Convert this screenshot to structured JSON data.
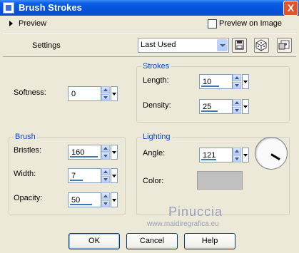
{
  "window": {
    "title": "Brush Strokes",
    "close": "X"
  },
  "preview": {
    "label": "Preview",
    "on_image_label": "Preview on Image",
    "on_image_checked": false
  },
  "settings": {
    "label": "Settings",
    "value": "Last Used"
  },
  "softness": {
    "label": "Softness:",
    "value": "0",
    "fill": 0
  },
  "strokes": {
    "title": "Strokes",
    "length": {
      "label": "Length:",
      "value": "10",
      "fill": 0.6
    },
    "density": {
      "label": "Density:",
      "value": "25",
      "fill": 0.55
    }
  },
  "brush": {
    "title": "Brush",
    "bristles": {
      "label": "Bristles:",
      "value": "160",
      "fill": 0.95
    },
    "width": {
      "label": "Width:",
      "value": "7",
      "fill": 0.45
    },
    "opacity": {
      "label": "Opacity:",
      "value": "50",
      "fill": 0.75
    }
  },
  "lighting": {
    "title": "Lighting",
    "angle": {
      "label": "Angle:",
      "value": "121",
      "fill": 0.5
    },
    "color": {
      "label": "Color:",
      "swatch": "#c0c0c0"
    }
  },
  "watermark": {
    "line1": "Pinuccia",
    "line2": "www.maidiregrafica.eu"
  },
  "buttons": {
    "ok": "OK",
    "cancel": "Cancel",
    "help": "Help"
  },
  "icons": [
    "app-icon",
    "save-icon",
    "dice-icon",
    "settings-icon"
  ]
}
